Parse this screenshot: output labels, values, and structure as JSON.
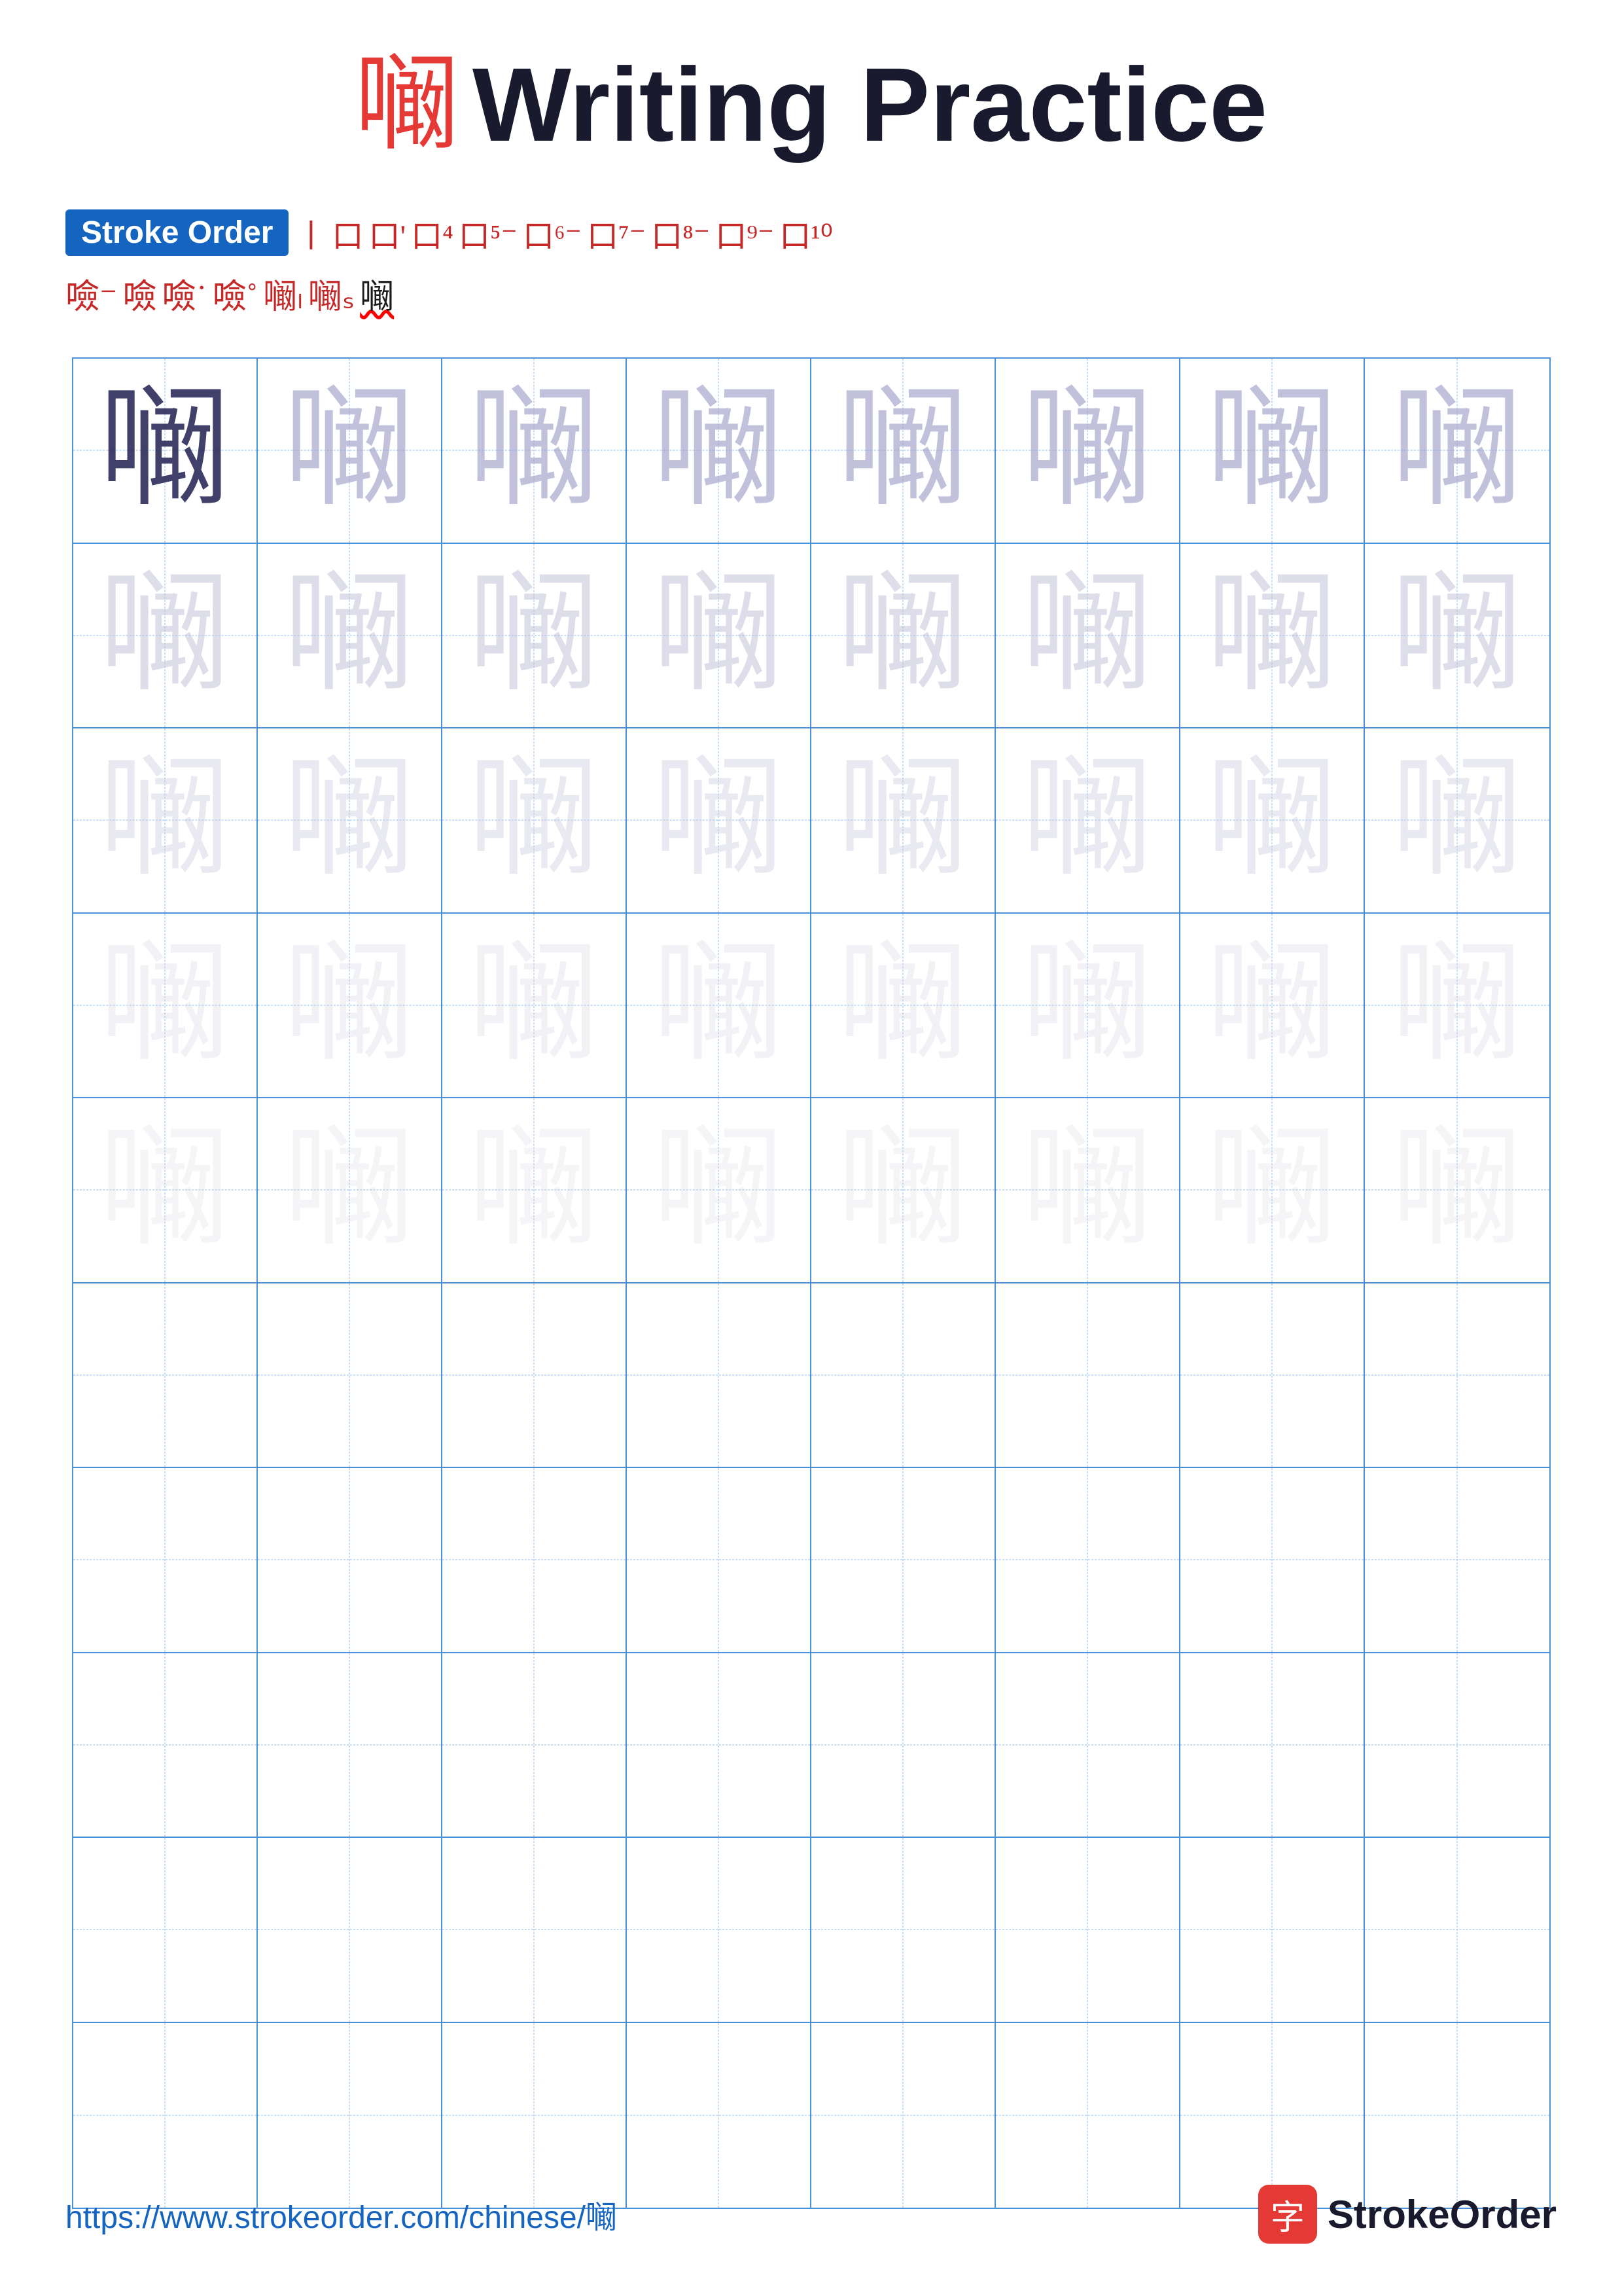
{
  "page": {
    "title_char": "㘎",
    "title_text": "Writing Practice",
    "stroke_order_label": "Stroke Order",
    "stroke_steps": [
      "㇔",
      "口",
      "口'",
      "口⁴",
      "口⁵",
      "口⁶",
      "口⁷",
      "口⁸",
      "口⁹",
      "口¹⁰",
      "噞⁻",
      "噞",
      "噞˙",
      "噞˚",
      "噞ˡ",
      "噞ˢ",
      "㘎"
    ],
    "practice_char": "㘎",
    "grid_rows": 10,
    "grid_cols": 8,
    "filled_rows": 5,
    "footer_url": "https://www.strokeorder.com/chinese/㘎",
    "brand_char": "字",
    "brand_name": "StrokeOrder"
  }
}
